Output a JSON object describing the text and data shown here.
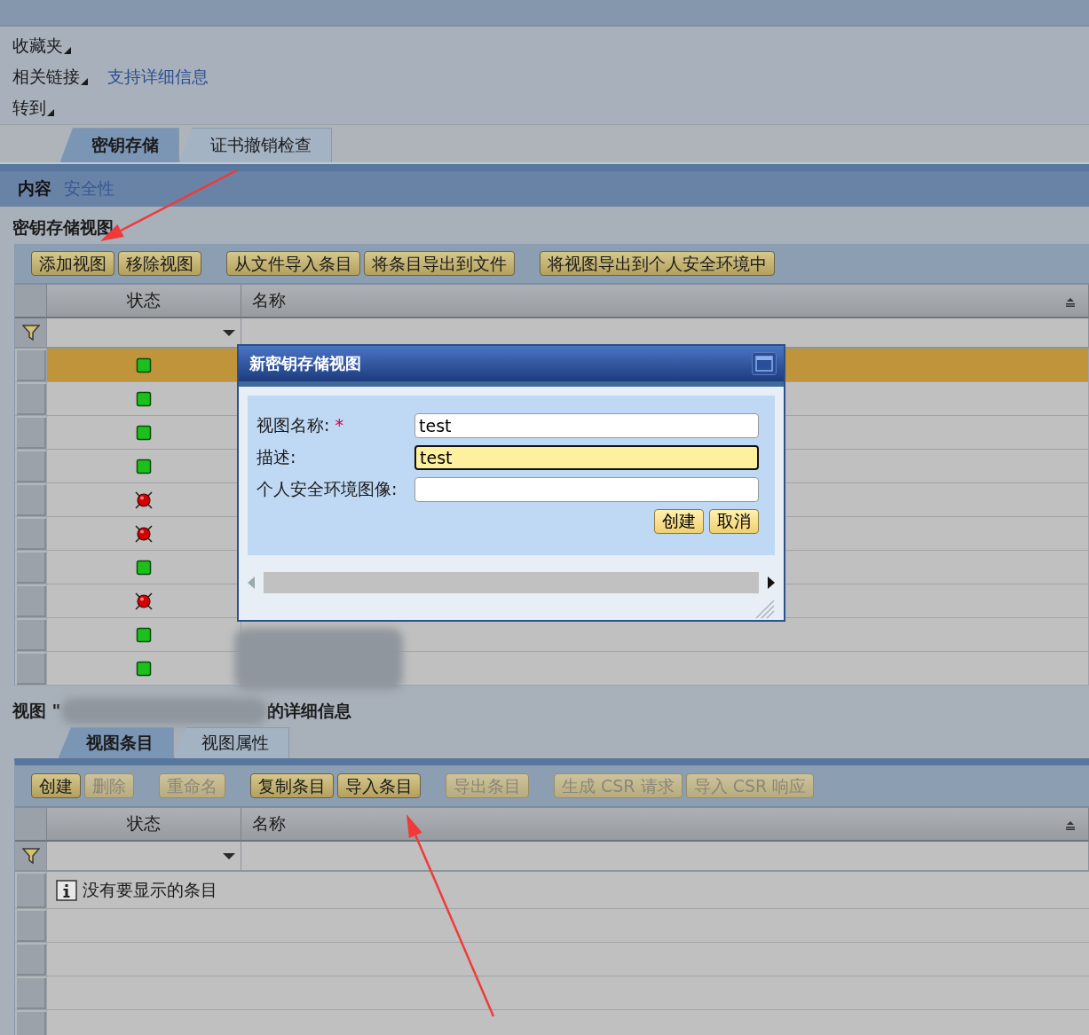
{
  "menu": [
    {
      "label": "收藏夹"
    },
    {
      "label": "相关链接",
      "link": "支持详细信息"
    },
    {
      "label": "转到"
    }
  ],
  "main_tabs": [
    {
      "label": "密钥存储",
      "selected": true
    },
    {
      "label": "证书撤销检查",
      "selected": false
    }
  ],
  "sub_nav": [
    {
      "label": "内容",
      "selected": true
    },
    {
      "label": "安全性",
      "selected": false
    }
  ],
  "views": {
    "title": "密钥存储视图",
    "toolbar": [
      [
        {
          "label": "添加视图",
          "disabled": false
        },
        {
          "label": "移除视图",
          "disabled": false
        }
      ],
      [
        {
          "label": "从文件导入条目",
          "disabled": false
        },
        {
          "label": "将条目导出到文件",
          "disabled": false
        }
      ],
      [
        {
          "label": "将视图导出到个人安全环境中",
          "disabled": false
        }
      ]
    ],
    "columns": [
      "状态",
      "名称"
    ],
    "rows": [
      {
        "selected": true,
        "kind": "ok"
      },
      {
        "selected": false,
        "kind": "ok"
      },
      {
        "selected": false,
        "kind": "ok"
      },
      {
        "selected": false,
        "kind": "ok"
      },
      {
        "selected": false,
        "kind": "error"
      },
      {
        "selected": false,
        "kind": "error"
      },
      {
        "selected": false,
        "kind": "ok"
      },
      {
        "selected": false,
        "kind": "error"
      },
      {
        "selected": false,
        "kind": "ok"
      },
      {
        "selected": false,
        "kind": "ok"
      }
    ]
  },
  "details": {
    "title_start": "视图 \"",
    "title_end": "的详细信息",
    "tabs": [
      {
        "label": "视图条目",
        "selected": true
      },
      {
        "label": "视图属性",
        "selected": false
      }
    ],
    "toolbar": [
      [
        {
          "label": "创建",
          "disabled": false
        },
        {
          "label": "删除",
          "disabled": true
        }
      ],
      [
        {
          "label": "重命名",
          "disabled": true
        }
      ],
      [
        {
          "label": "复制条目",
          "disabled": false
        },
        {
          "label": "导入条目",
          "disabled": false
        }
      ],
      [
        {
          "label": "导出条目",
          "disabled": true
        }
      ],
      [
        {
          "label": "生成 CSR 请求",
          "disabled": true
        },
        {
          "label": "导入 CSR 响应",
          "disabled": true
        }
      ]
    ],
    "columns": [
      "状态",
      "名称"
    ],
    "message": "没有要显示的条目"
  },
  "dialog": {
    "title": "新密钥存储视图",
    "fields": [
      {
        "label": "视图名称:",
        "required_mark": "*",
        "value": "test",
        "focused": false
      },
      {
        "label": "描述:",
        "value": "test",
        "focused": true
      },
      {
        "label": "个人安全环境图像:",
        "focused": false
      }
    ],
    "buttons": [
      "创建",
      "取消"
    ]
  }
}
